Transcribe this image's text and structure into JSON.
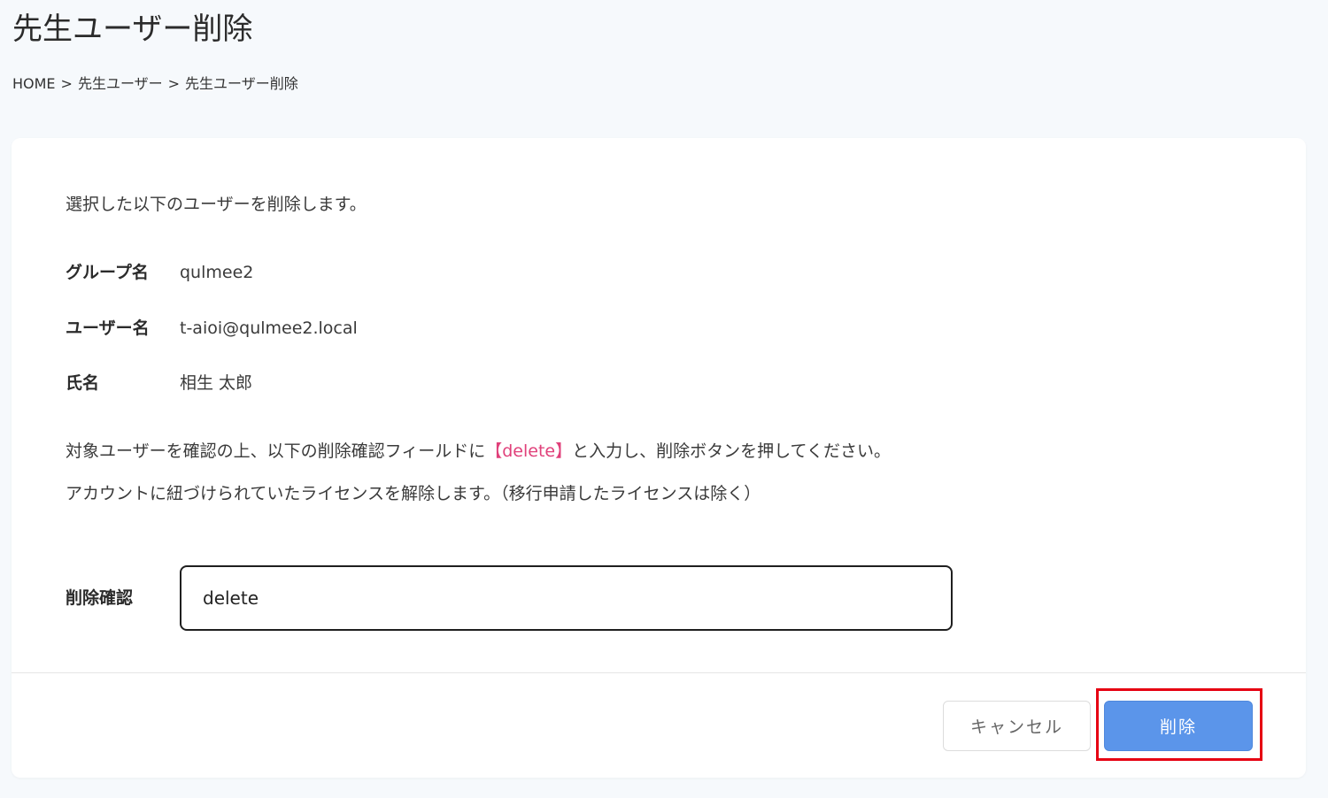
{
  "page": {
    "title": "先生ユーザー削除"
  },
  "breadcrumb": {
    "home": "HOME",
    "separator": ">",
    "parent": "先生ユーザー",
    "current": "先生ユーザー削除"
  },
  "card": {
    "intro": "選択した以下のユーザーを削除します。",
    "fields": {
      "group": {
        "label": "グループ名",
        "value": "qulmee2"
      },
      "user": {
        "label": "ユーザー名",
        "value": "t-aioi@qulmee2.local"
      },
      "name": {
        "label": "氏名",
        "value": "相生 太郎"
      }
    },
    "notice_line1_pre": "対象ユーザーを確認の上、以下の削除確認フィールドに",
    "notice_line1_keyword": "【delete】",
    "notice_line1_post": "と入力し、削除ボタンを押してください。",
    "notice_line2": "アカウントに紐づけられていたライセンスを解除します。（移行申請したライセンスは除く）",
    "confirm": {
      "label": "削除確認",
      "value": "delete"
    }
  },
  "actions": {
    "cancel_label": "キャンセル",
    "delete_label": "削除"
  },
  "colors": {
    "background": "#f6f9fc",
    "card": "#ffffff",
    "primary_button": "#5b95ea",
    "keyword_highlight": "#e0407a",
    "annotation_border": "#e60012"
  }
}
